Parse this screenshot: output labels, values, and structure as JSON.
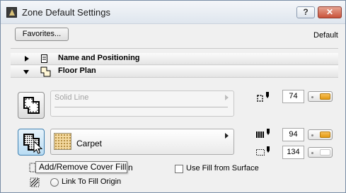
{
  "window": {
    "title": "Zone Default Settings"
  },
  "titlebar": {
    "help_label": "?",
    "close_label": "✕"
  },
  "toolbar": {
    "favorites_label": "Favorites...",
    "default_label": "Default"
  },
  "sections": [
    {
      "label": "Name and Positioning",
      "expanded": false,
      "icon": "zone-stamp-icon"
    },
    {
      "label": "Floor Plan",
      "expanded": true,
      "icon": "floor-plan-icon"
    }
  ],
  "floor_plan": {
    "line_type": {
      "label": "Solid Line",
      "enabled": false
    },
    "line_pen": {
      "value": "74",
      "toggle": "on"
    },
    "fill": {
      "label": "Carpet",
      "swatch_color": "#f4d9a0"
    },
    "fill_pen": {
      "value": "94",
      "toggle": "on"
    },
    "fill_background_pen": {
      "value": "134",
      "toggle": "off"
    },
    "tooltip": "Add/Remove Cover Fill",
    "tooltip_tail": "n",
    "use_fill_from_surface": {
      "label": "Use Fill from Surface",
      "checked": false
    },
    "link_to_fill_origin": {
      "label": "Link To Fill Origin",
      "selected": false
    }
  },
  "colors": {
    "accent_toggle": "#e39a12",
    "close_button": "#c8523a",
    "active_button": "#b9dcf3"
  }
}
